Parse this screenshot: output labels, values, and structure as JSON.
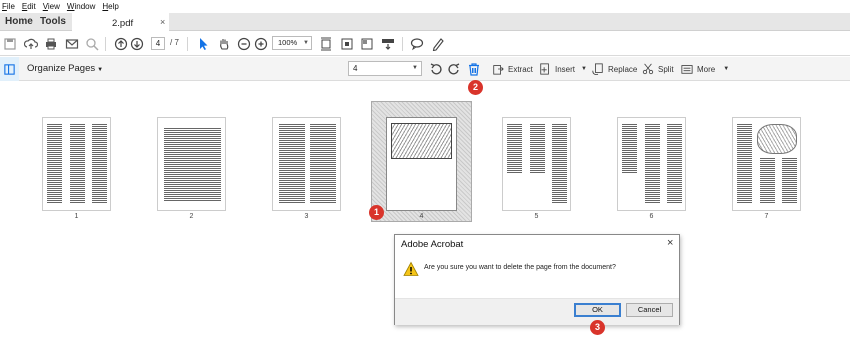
{
  "menu": [
    "File",
    "Edit",
    "View",
    "Window",
    "Help"
  ],
  "tabs": {
    "home": "Home",
    "tools": "Tools",
    "document": "2.pdf",
    "close": "×"
  },
  "toolbar": {
    "current_page": "4",
    "page_total": "/ 7",
    "zoom": "100%"
  },
  "organize": {
    "title": "Organize Pages",
    "page_select_value": "4",
    "extract": "Extract",
    "insert": "Insert",
    "replace": "Replace",
    "split": "Split",
    "more": "More"
  },
  "thumbnails": [
    {
      "page": "1"
    },
    {
      "page": "2"
    },
    {
      "page": "3"
    },
    {
      "page": "4"
    },
    {
      "page": "5"
    },
    {
      "page": "6"
    },
    {
      "page": "7"
    }
  ],
  "selected_page": "4",
  "badges": [
    "1",
    "2",
    "3"
  ],
  "dialog": {
    "title": "Adobe Acrobat",
    "message": "Are you sure you want to delete the page from the document?",
    "ok": "OK",
    "cancel": "Cancel",
    "close": "×"
  },
  "colors": {
    "badge": "#d9342b",
    "accent": "#1473e6",
    "warning": "#f5c518"
  }
}
